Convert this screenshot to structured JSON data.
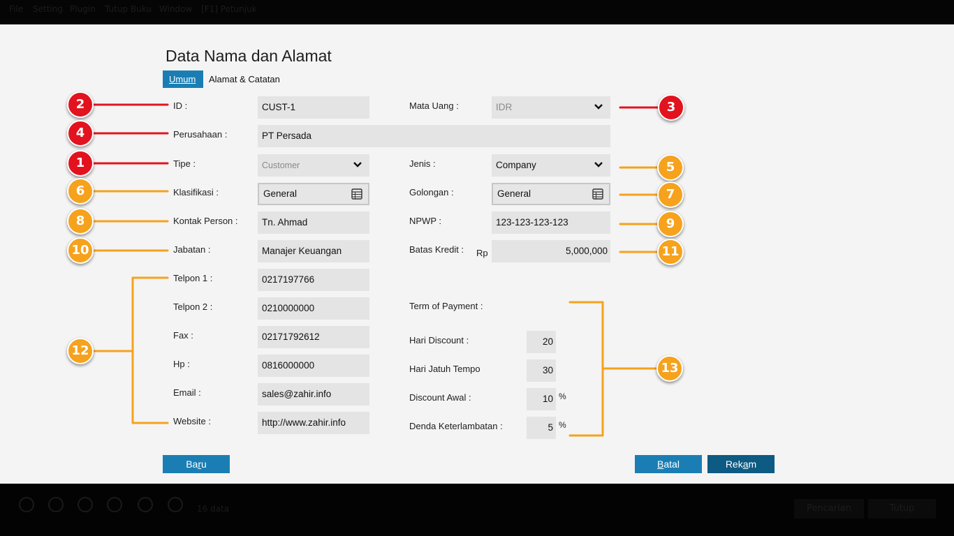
{
  "menubar": {
    "items": [
      "File",
      "Setting",
      "Plugin",
      "Tutup Buku",
      "Window",
      "[F1] Petunjuk"
    ]
  },
  "background_app": {
    "count_label": "16 data",
    "buttons": [
      "Pencarian",
      "Tutup"
    ]
  },
  "dialog": {
    "title": "Data Nama dan Alamat",
    "tabs": [
      {
        "label": "Umum",
        "active": true
      },
      {
        "label": "Alamat & Catatan",
        "active": false
      }
    ],
    "fields": {
      "id": {
        "label": "ID :",
        "value": "CUST-1"
      },
      "perusahaan": {
        "label": "Perusahaan :",
        "value": "PT Persada"
      },
      "tipe": {
        "label": "Tipe :",
        "value": "Customer"
      },
      "klasifikasi": {
        "label": "Klasifikasi :",
        "value": "General"
      },
      "kontak_person": {
        "label": "Kontak Person :",
        "value": "Tn. Ahmad"
      },
      "jabatan": {
        "label": "Jabatan :",
        "value": "Manajer Keuangan"
      },
      "telpon1": {
        "label": "Telpon 1 :",
        "value": "0217197766"
      },
      "telpon2": {
        "label": "Telpon 2 :",
        "value": "0210000000"
      },
      "fax": {
        "label": "Fax :",
        "value": "02171792612"
      },
      "hp": {
        "label": "Hp :",
        "value": "0816000000"
      },
      "email": {
        "label": "Email :",
        "value": "sales@zahir.info"
      },
      "website": {
        "label": "Website :",
        "value": "http://www.zahir.info"
      },
      "mata_uang": {
        "label": "Mata Uang :",
        "value": "IDR"
      },
      "jenis": {
        "label": "Jenis :",
        "value": "Company"
      },
      "golongan": {
        "label": "Golongan :",
        "value": "General"
      },
      "npwp": {
        "label": "NPWP :",
        "value": "123-123-123-123"
      },
      "batas_kredit": {
        "label": "Batas Kredit :",
        "currency": "Rp",
        "value": "5,000,000"
      },
      "term_of_payment": {
        "label": "Term of Payment :"
      },
      "hari_discount": {
        "label": "Hari Discount :",
        "value": "20"
      },
      "hari_jatuh_tempo": {
        "label": "Hari Jatuh Tempo",
        "value": "30"
      },
      "discount_awal": {
        "label": "Discount Awal :",
        "value": "10",
        "unit": "%"
      },
      "denda_keterlambatan": {
        "label": "Denda Keterlambatan :",
        "value": "5",
        "unit": "%"
      }
    },
    "buttons": {
      "baru": {
        "pre": "Ba",
        "u": "r",
        "post": "u"
      },
      "batal": {
        "pre": "",
        "u": "B",
        "post": "atal"
      },
      "rekam": {
        "pre": "Rek",
        "u": "a",
        "post": "m"
      }
    }
  },
  "callouts": [
    "1",
    "2",
    "3",
    "4",
    "5",
    "6",
    "7",
    "8",
    "9",
    "10",
    "11",
    "12",
    "13"
  ],
  "colors": {
    "accent": "#1a7eb4",
    "accent_dark": "#0d5a82",
    "callout_red": "#e2131e",
    "callout_orange": "#f6a21d",
    "dialog_bg": "#f4f4f4",
    "field_bg": "#e4e4e4"
  }
}
